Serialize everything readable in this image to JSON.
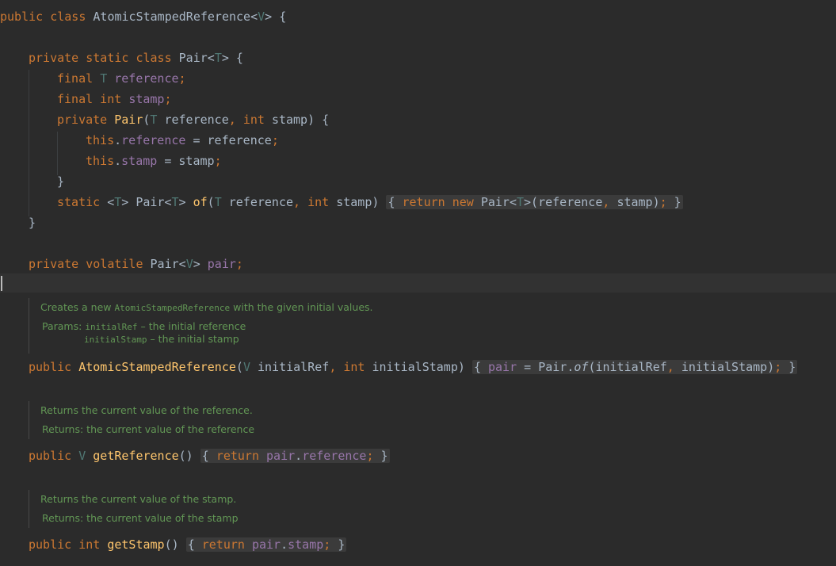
{
  "code": {
    "class_decl": {
      "kw": "public class",
      "name": "AtomicStampedReference",
      "tparam": "V",
      "open": "{"
    },
    "pair_class": {
      "kw": "private static class",
      "name": "Pair",
      "tparam": "T",
      "open": "{"
    },
    "field_ref": {
      "kw": "final",
      "type": "T",
      "name": "reference",
      "end": ";"
    },
    "field_stamp": {
      "kw": "final int",
      "name": "stamp",
      "end": ";"
    },
    "ctor": {
      "kw": "private",
      "name": "Pair",
      "p1type": "T",
      "p1": "reference",
      "p2type": "int",
      "p2": "stamp",
      "open": "{"
    },
    "assign1": {
      "this": "this",
      "field": "reference",
      "rhs": "reference"
    },
    "assign2": {
      "this": "this",
      "field": "stamp",
      "rhs": "stamp"
    },
    "close_ctor": "}",
    "of_method": {
      "kw": "static",
      "tparam": "T",
      "ret": "Pair",
      "name": "of",
      "p1type": "T",
      "p1": "reference",
      "p2type": "int",
      "p2": "stamp",
      "body_kw1": "return",
      "body_kw2": "new",
      "body_type": "Pair",
      "body_args": "reference",
      "body_args2": "stamp"
    },
    "close_pair": "}",
    "pair_field": {
      "kw": "private volatile",
      "type": "Pair",
      "tparam": "V",
      "name": "pair"
    },
    "doc1": {
      "summary_pre": "Creates a new ",
      "summary_code": "AtomicStampedReference",
      "summary_post": " with the given initial values.",
      "params_label": "Params:",
      "p1_code": "initialRef",
      "p1_desc": " – the initial reference",
      "p2_code": "initialStamp",
      "p2_desc": " – the initial stamp"
    },
    "ctor_main": {
      "kw": "public",
      "name": "AtomicStampedReference",
      "p1type": "V",
      "p1": "initialRef",
      "p2type": "int",
      "p2": "initialStamp",
      "lhs": "pair",
      "call_cls": "Pair",
      "call_fn": "of",
      "a1": "initialRef",
      "a2": "initialStamp"
    },
    "doc2": {
      "summary": "Returns the current value of the reference.",
      "returns": "Returns: the current value of the reference"
    },
    "get_ref": {
      "kw": "public",
      "type": "V",
      "name": "getReference",
      "ret_kw": "return",
      "obj": "pair",
      "field": "reference"
    },
    "doc3": {
      "summary": "Returns the current value of the stamp.",
      "returns": "Returns: the current value of the stamp"
    },
    "get_stamp": {
      "kw": "public int",
      "name": "getStamp",
      "ret_kw": "return",
      "obj": "pair",
      "field": "stamp"
    }
  },
  "colors": {
    "background": "#2b2b2b",
    "keyword": "#cc7832",
    "type_param": "#507874",
    "field": "#9876aa",
    "method": "#ffc66d",
    "doc": "#629755",
    "text": "#a9b7c6"
  }
}
